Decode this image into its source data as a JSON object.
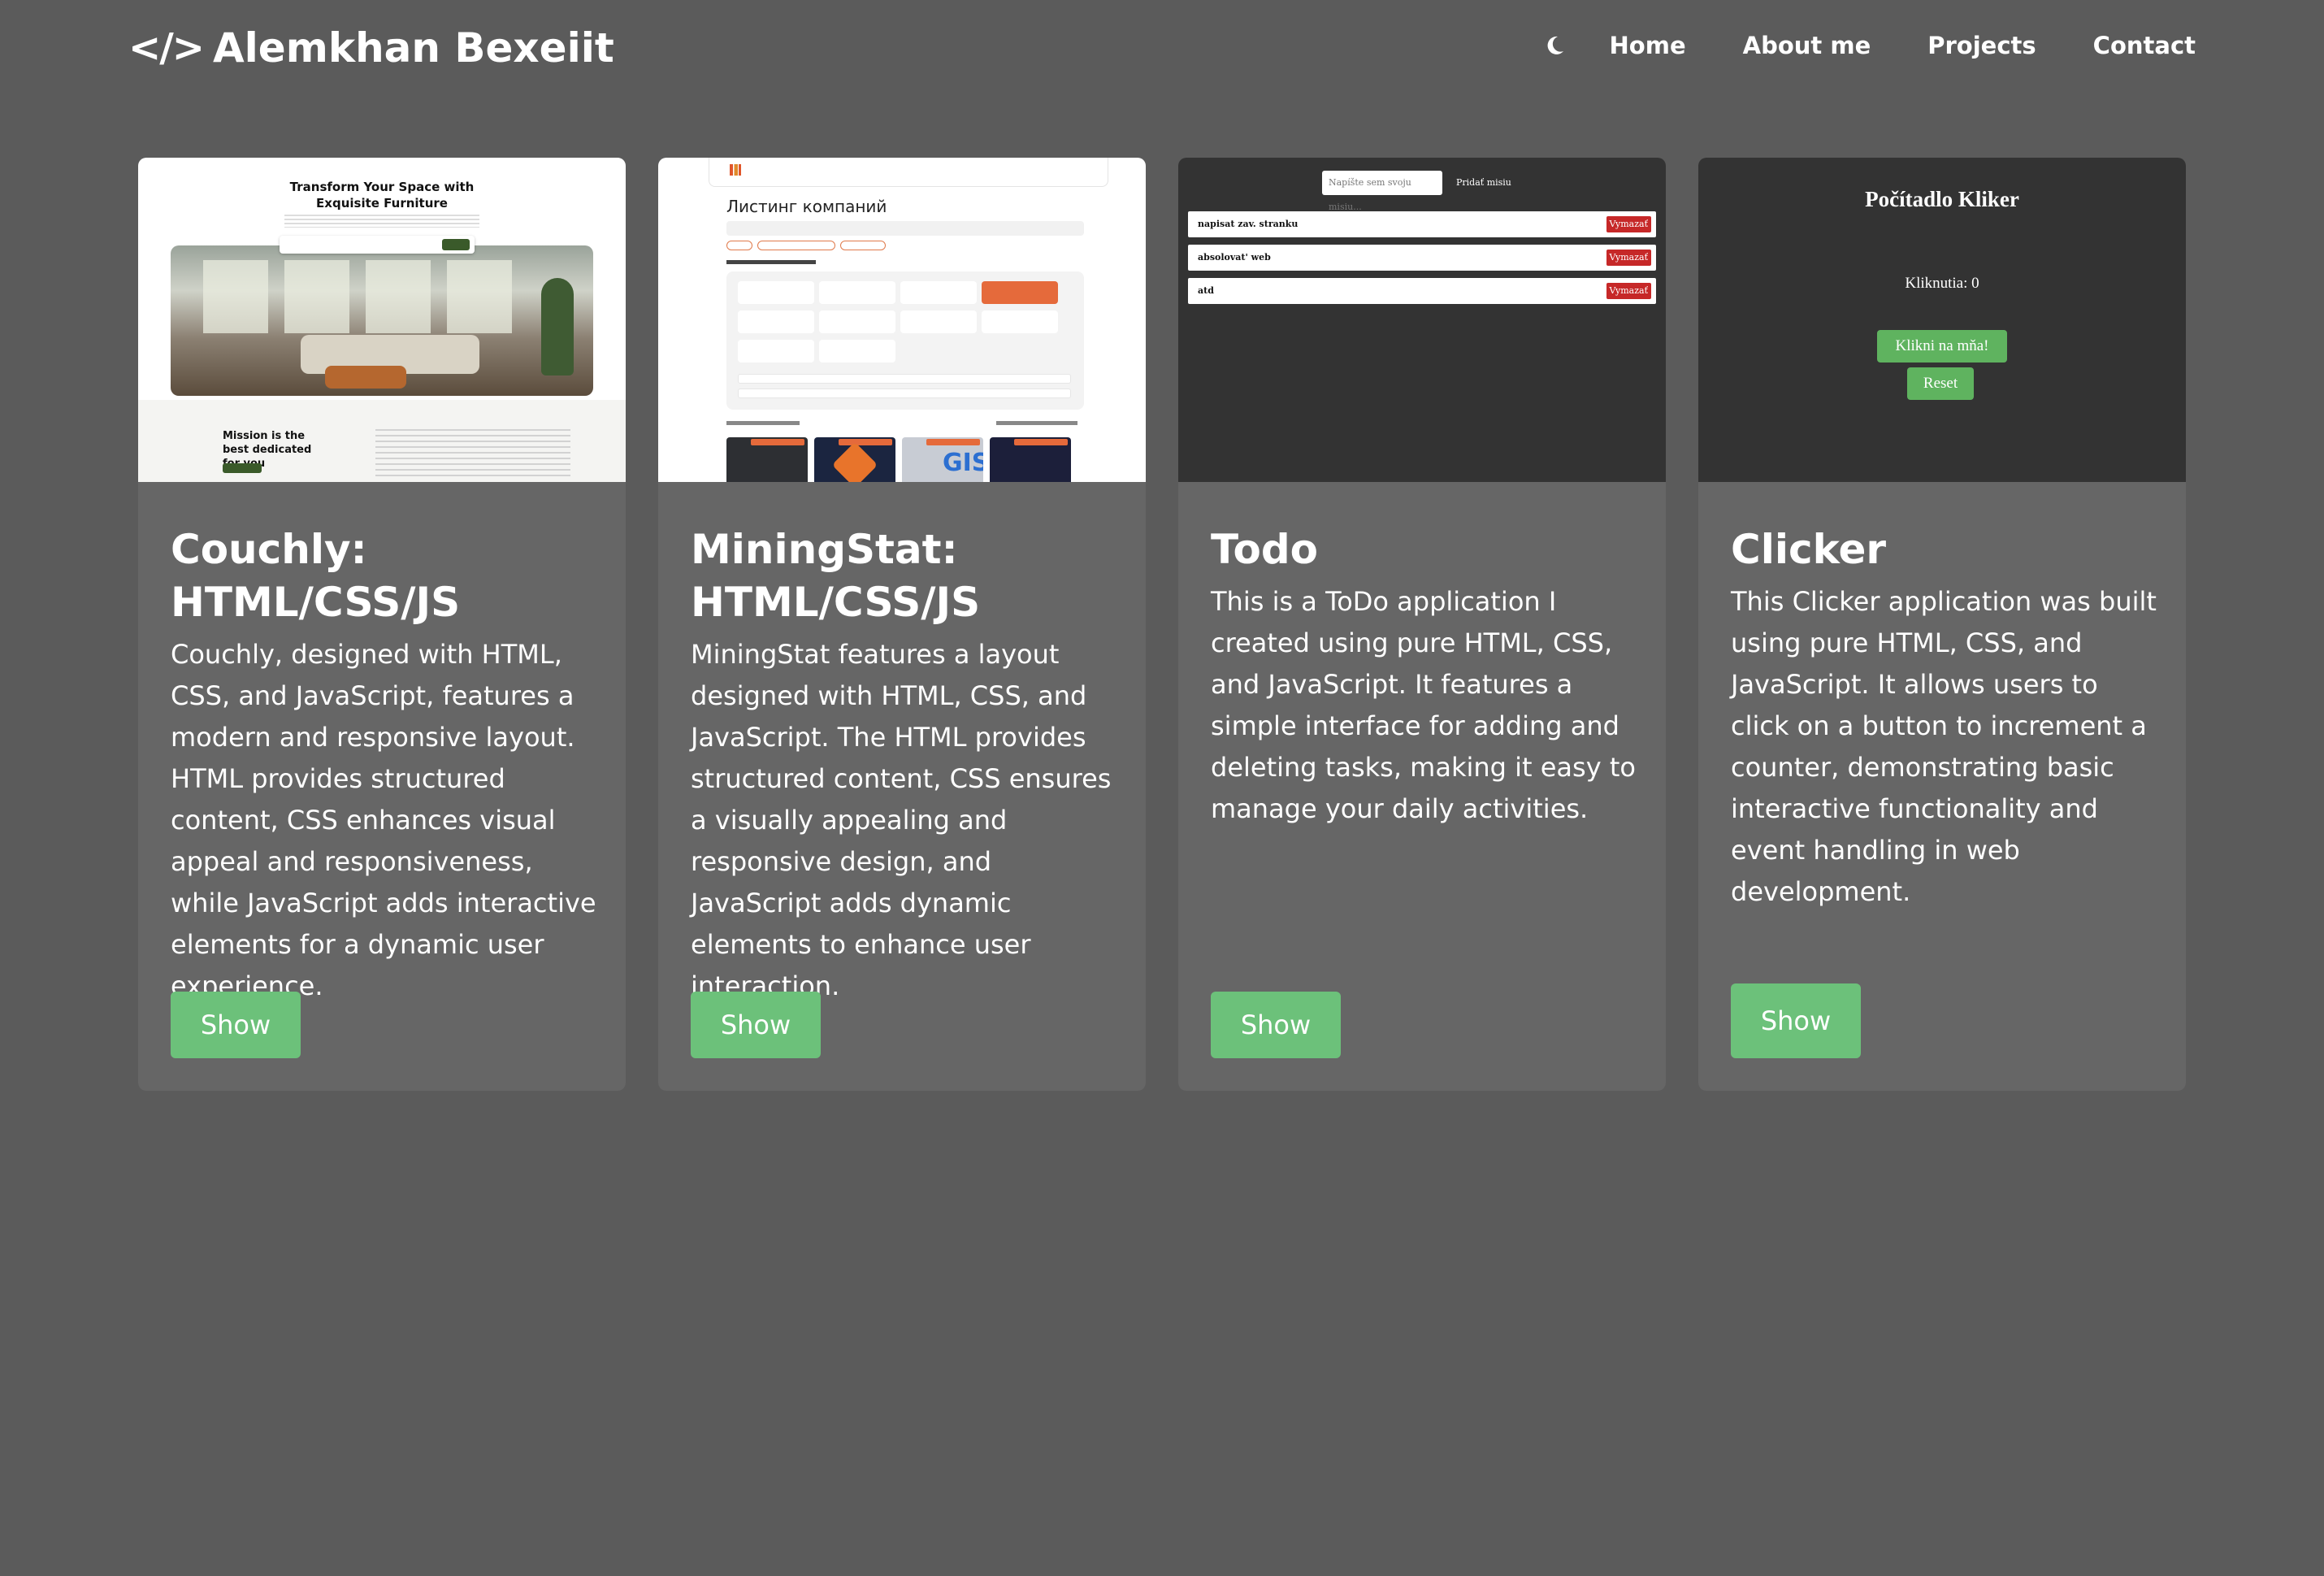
{
  "header": {
    "logo_icon": "</>",
    "logo_text": "Alemkhan Bexeiit",
    "theme_toggle_icon": "moon-icon",
    "nav": [
      "Home",
      "About me",
      "Projects",
      "Contact"
    ]
  },
  "colors": {
    "background": "#5b5b5b",
    "card": "#666666",
    "button": "#6cc17a",
    "text": "#ffffff"
  },
  "cards": [
    {
      "title": "Couchly: HTML/CSS/JS",
      "description": "Couchly, designed with HTML, CSS, and JavaScript, features a modern and responsive layout. HTML provides structured content, CSS enhances visual appeal and responsiveness, while JavaScript adds interactive elements for a dynamic user experience.",
      "button": "Show",
      "thumbnail": {
        "hero_title": "Transform Your Space with Exquisite Furniture",
        "mission": "Mission is the best dedicated for you"
      }
    },
    {
      "title": "MiningStat: HTML/CSS/JS",
      "description": "MiningStat features a layout designed with HTML, CSS, and JavaScript. The HTML provides structured content, CSS ensures a visually appealing and responsive design, and JavaScript adds dynamic elements to enhance user interaction.",
      "button": "Show",
      "thumbnail": {
        "heading": "Листинг компаний",
        "badge": "GIS"
      }
    },
    {
      "title": "Todo",
      "description": "This is a ToDo application I created using pure HTML, CSS, and JavaScript. It features a simple interface for adding and deleting tasks, making it easy to manage your daily activities.",
      "button": "Show",
      "thumbnail": {
        "input_placeholder": "Napíšte sem svoju misiu...",
        "add_button": "Pridať misiu",
        "items": [
          "napisat zav. stranku",
          "absolovat' web",
          "atd"
        ],
        "delete_label": "Vymazať"
      }
    },
    {
      "title": "Clicker",
      "description": "This Clicker application was built using pure HTML, CSS, and JavaScript. It allows users to click on a button to increment a counter, demonstrating basic interactive functionality and event handling in web development.",
      "button": "Show",
      "thumbnail": {
        "title": "Počítadlo Kliker",
        "count_label": "Kliknutia: 0",
        "click_button": "Klikni na mňa!",
        "reset_button": "Reset"
      }
    }
  ]
}
